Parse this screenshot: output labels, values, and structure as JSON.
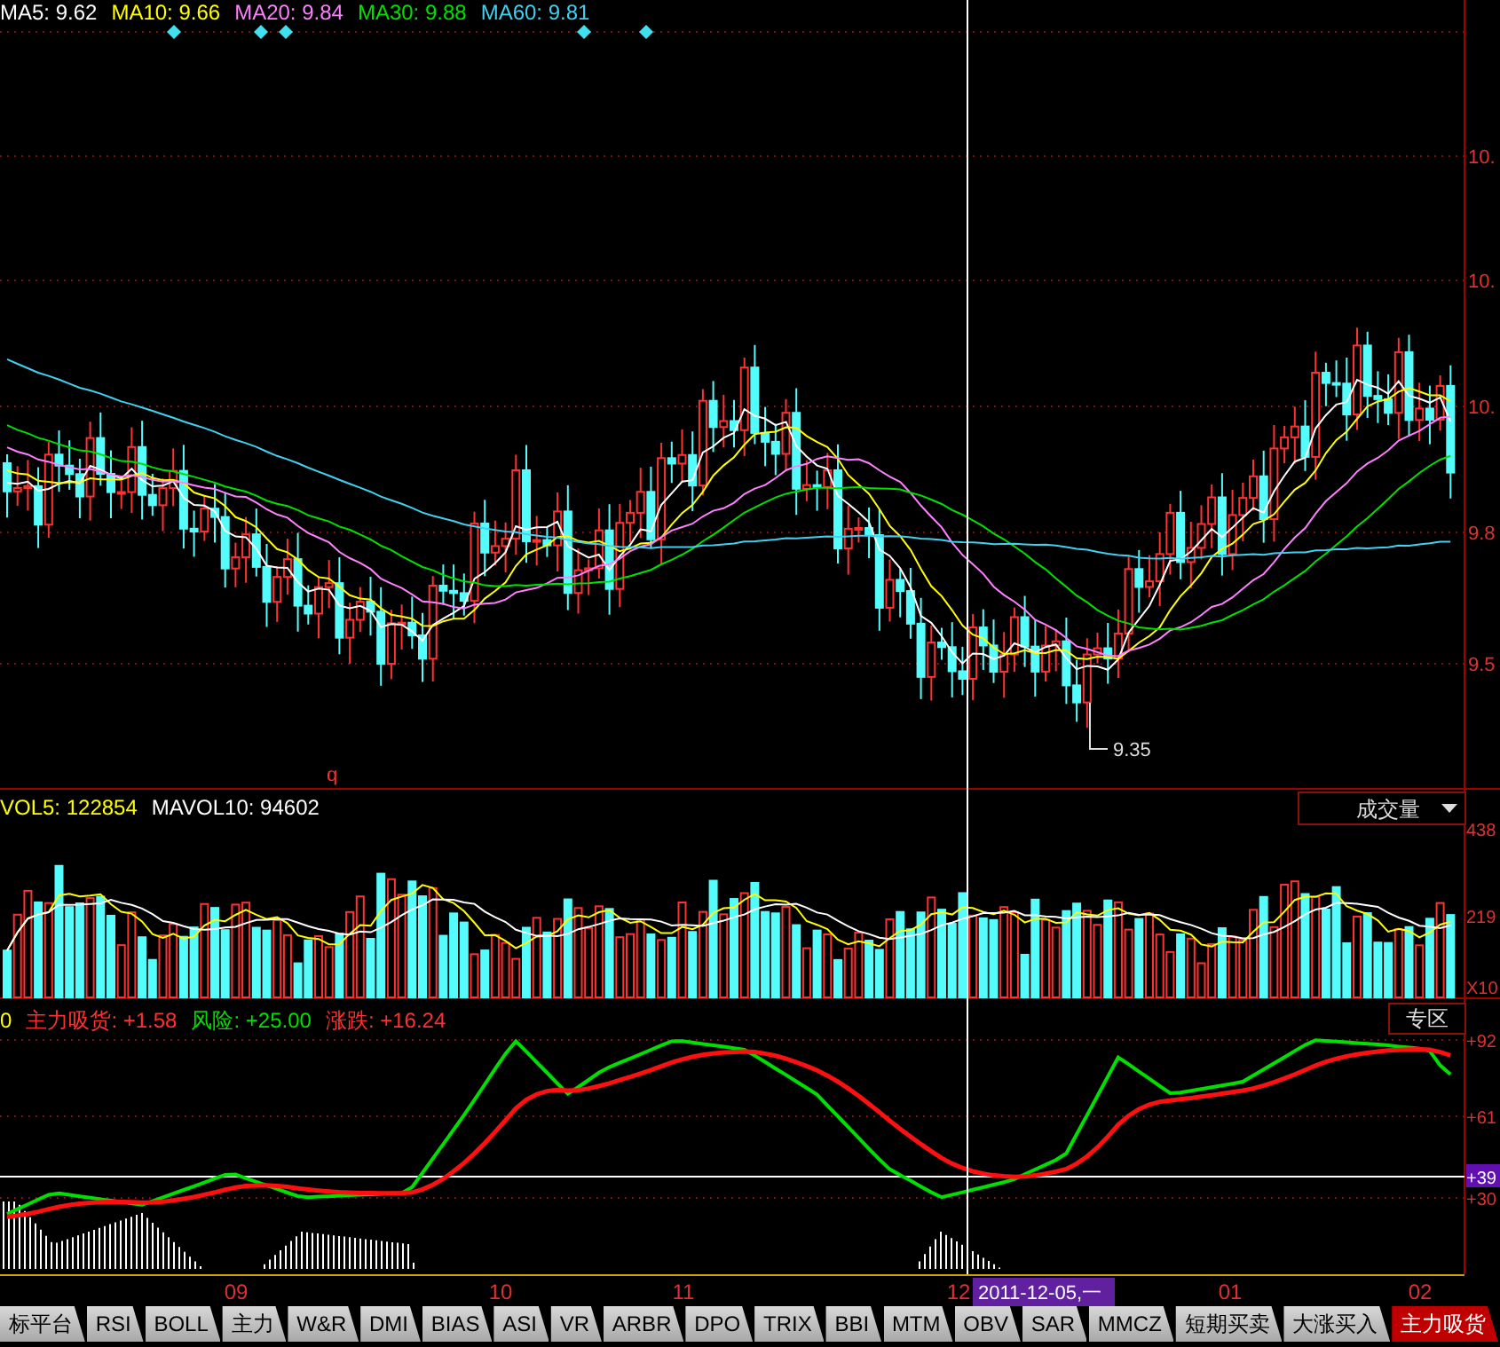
{
  "ma_legend": [
    {
      "label": "MA5: 9.62",
      "color": "#ffffff"
    },
    {
      "label": "MA10: 9.66",
      "color": "#ffff00"
    },
    {
      "label": "MA20: 9.84",
      "color": "#ff80ff"
    },
    {
      "label": "MA30: 9.88",
      "color": "#00e000"
    },
    {
      "label": "MA60: 9.81",
      "color": "#40d0f0"
    }
  ],
  "price_axis": [
    "10.",
    "10.",
    "10.",
    "9.8",
    "9.5"
  ],
  "low_marker": "9.35",
  "marker_letter": "q",
  "volume": {
    "legend": [
      {
        "label": "VOL5: 122854",
        "color": "#ffff00"
      },
      {
        "label": "MAVOL10: 94602",
        "color": "#ffffff"
      }
    ],
    "selector": "成交量",
    "axis": [
      "438",
      "219",
      "X10"
    ]
  },
  "indicator": {
    "legend": [
      {
        "label": "0",
        "color": "#ffff00"
      },
      {
        "label": "主力吸货: +1.58",
        "color": "#ff3030"
      },
      {
        "label": "风险: +25.00",
        "color": "#00e000"
      },
      {
        "label": "涨跌: +16.24",
        "color": "#ff3030"
      }
    ],
    "zone_button": "专区",
    "axis": [
      {
        "label": "+92",
        "highlight": false
      },
      {
        "label": "+61",
        "highlight": false
      },
      {
        "label": "+39",
        "highlight": true
      },
      {
        "label": "+30",
        "highlight": false
      }
    ]
  },
  "x_axis": [
    "09",
    "10",
    "11",
    "12",
    "01",
    "02"
  ],
  "cursor_date": "2011-12-05,一",
  "tabs": [
    {
      "label": "标平台",
      "selected": false
    },
    {
      "label": "RSI",
      "selected": false
    },
    {
      "label": "BOLL",
      "selected": false
    },
    {
      "label": "主力",
      "selected": false
    },
    {
      "label": "W&R",
      "selected": false
    },
    {
      "label": "DMI",
      "selected": false
    },
    {
      "label": "BIAS",
      "selected": false
    },
    {
      "label": "ASI",
      "selected": false
    },
    {
      "label": "VR",
      "selected": false
    },
    {
      "label": "ARBR",
      "selected": false
    },
    {
      "label": "DPO",
      "selected": false
    },
    {
      "label": "TRIX",
      "selected": false
    },
    {
      "label": "BBI",
      "selected": false
    },
    {
      "label": "MTM",
      "selected": false
    },
    {
      "label": "OBV",
      "selected": false
    },
    {
      "label": "SAR",
      "selected": false
    },
    {
      "label": "MMCZ",
      "selected": false
    },
    {
      "label": "短期买卖",
      "selected": false
    },
    {
      "label": "大涨买入",
      "selected": false
    },
    {
      "label": "主力吸货",
      "selected": true
    }
  ]
}
